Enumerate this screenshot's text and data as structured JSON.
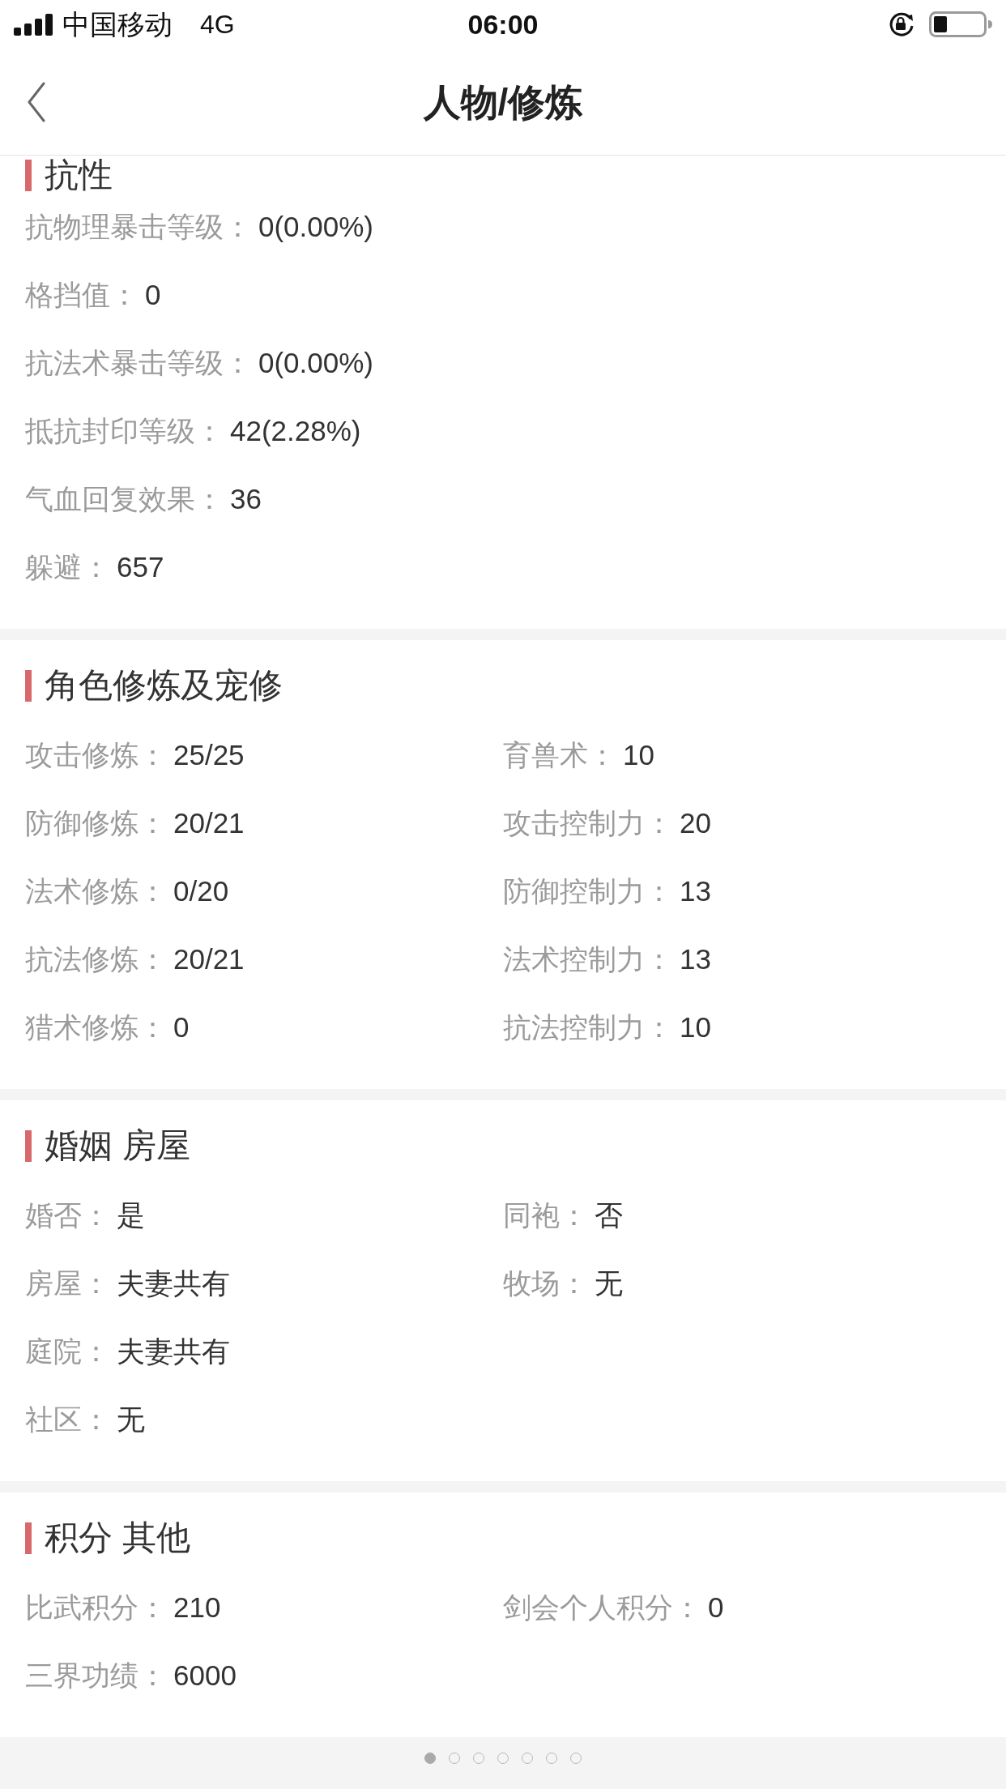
{
  "status_bar": {
    "carrier": "中国移动",
    "network": "4G",
    "time": "06:00"
  },
  "nav": {
    "title": "人物/修炼"
  },
  "sections": [
    {
      "title": "抗性",
      "rows": [
        [
          {
            "label": "抗物理暴击等级：",
            "value": "0(0.00%)"
          }
        ],
        [
          {
            "label": "格挡值：",
            "value": "0"
          }
        ],
        [
          {
            "label": "抗法术暴击等级：",
            "value": "0(0.00%)"
          }
        ],
        [
          {
            "label": "抵抗封印等级：",
            "value": "42(2.28%)"
          }
        ],
        [
          {
            "label": "气血回复效果：",
            "value": "36"
          }
        ],
        [
          {
            "label": "躲避：",
            "value": "657"
          }
        ]
      ]
    },
    {
      "title": "角色修炼及宠修",
      "rows": [
        [
          {
            "label": "攻击修炼：",
            "value": "25/25"
          },
          {
            "label": "育兽术：",
            "value": "10"
          }
        ],
        [
          {
            "label": "防御修炼：",
            "value": "20/21"
          },
          {
            "label": "攻击控制力：",
            "value": "20"
          }
        ],
        [
          {
            "label": "法术修炼：",
            "value": "0/20"
          },
          {
            "label": "防御控制力：",
            "value": "13"
          }
        ],
        [
          {
            "label": "抗法修炼：",
            "value": "20/21"
          },
          {
            "label": "法术控制力：",
            "value": "13"
          }
        ],
        [
          {
            "label": "猎术修炼：",
            "value": "0"
          },
          {
            "label": "抗法控制力：",
            "value": "10"
          }
        ]
      ]
    },
    {
      "title": "婚姻 房屋",
      "rows": [
        [
          {
            "label": "婚否：",
            "value": "是"
          },
          {
            "label": "同袍：",
            "value": "否"
          }
        ],
        [
          {
            "label": "房屋：",
            "value": "夫妻共有"
          },
          {
            "label": "牧场：",
            "value": "无"
          }
        ],
        [
          {
            "label": "庭院：",
            "value": "夫妻共有"
          }
        ],
        [
          {
            "label": "社区：",
            "value": "无"
          }
        ]
      ]
    },
    {
      "title": "积分 其他",
      "rows": [
        [
          {
            "label": "比武积分：",
            "value": "210"
          },
          {
            "label": "剑会个人积分：",
            "value": "0"
          }
        ],
        [
          {
            "label": "三界功绩：",
            "value": "6000"
          }
        ]
      ]
    }
  ],
  "pager": {
    "dots": [
      {
        "selected": true
      },
      {
        "selected": false
      },
      {
        "selected": false
      },
      {
        "selected": false
      },
      {
        "selected": false
      },
      {
        "selected": false
      },
      {
        "selected": false
      }
    ]
  }
}
